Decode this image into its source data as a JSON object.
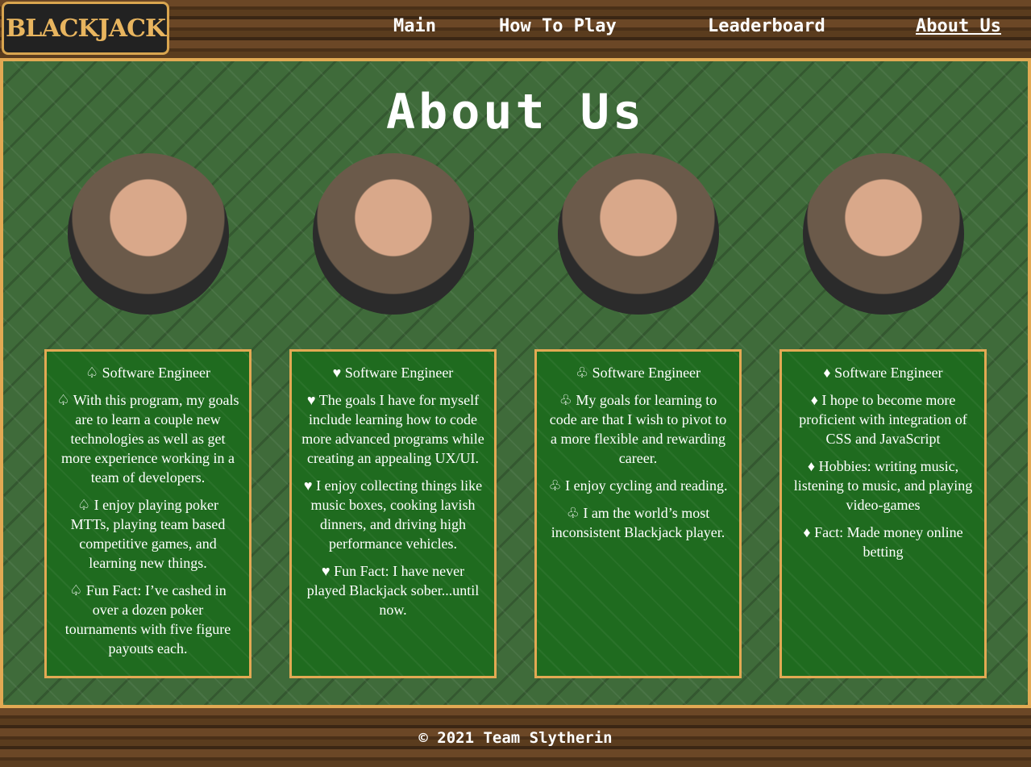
{
  "header": {
    "logo_text": "BLACKJACK",
    "nav": [
      {
        "label": "Main"
      },
      {
        "label": "How To Play"
      },
      {
        "label": "Leaderboard"
      },
      {
        "label": "About Us"
      }
    ]
  },
  "main": {
    "title": "About Us",
    "members": [
      {
        "paragraphs": [
          "♤ Software Engineer",
          "♤ With this program, my goals are to learn a couple new technologies as well as get more experience working in a team of developers.",
          "♤ I enjoy playing poker MTTs, playing team based competitive games, and learning new things.",
          "♤ Fun Fact: I’ve cashed in over a dozen poker tournaments with five figure payouts each."
        ]
      },
      {
        "paragraphs": [
          "♥ Software Engineer",
          "♥ The goals I have for myself include learning how to code more advanced programs while creating an appealing UX/UI.",
          "♥ I enjoy collecting things like music boxes, cooking lavish dinners, and driving high performance vehicles.",
          "♥ Fun Fact: I have never played Blackjack sober...until now."
        ]
      },
      {
        "paragraphs": [
          "♧ Software Engineer",
          "♧ My goals for learning to code are that I wish to pivot to a more flexible and rewarding career.",
          "♧ I enjoy cycling and reading.",
          "♧ I am the world’s most inconsistent Blackjack player."
        ]
      },
      {
        "paragraphs": [
          "♦ Software Engineer",
          "♦ I hope to become more proficient with integration of CSS and JavaScript",
          "♦ Hobbies: writing music, listening to music, and playing video-games",
          "♦ Fact: Made money online betting"
        ]
      }
    ]
  },
  "footer": {
    "text": "© 2021 Team Slytherin"
  },
  "colors": {
    "gold": "#e2a953",
    "felt": "#1f6b1f"
  }
}
